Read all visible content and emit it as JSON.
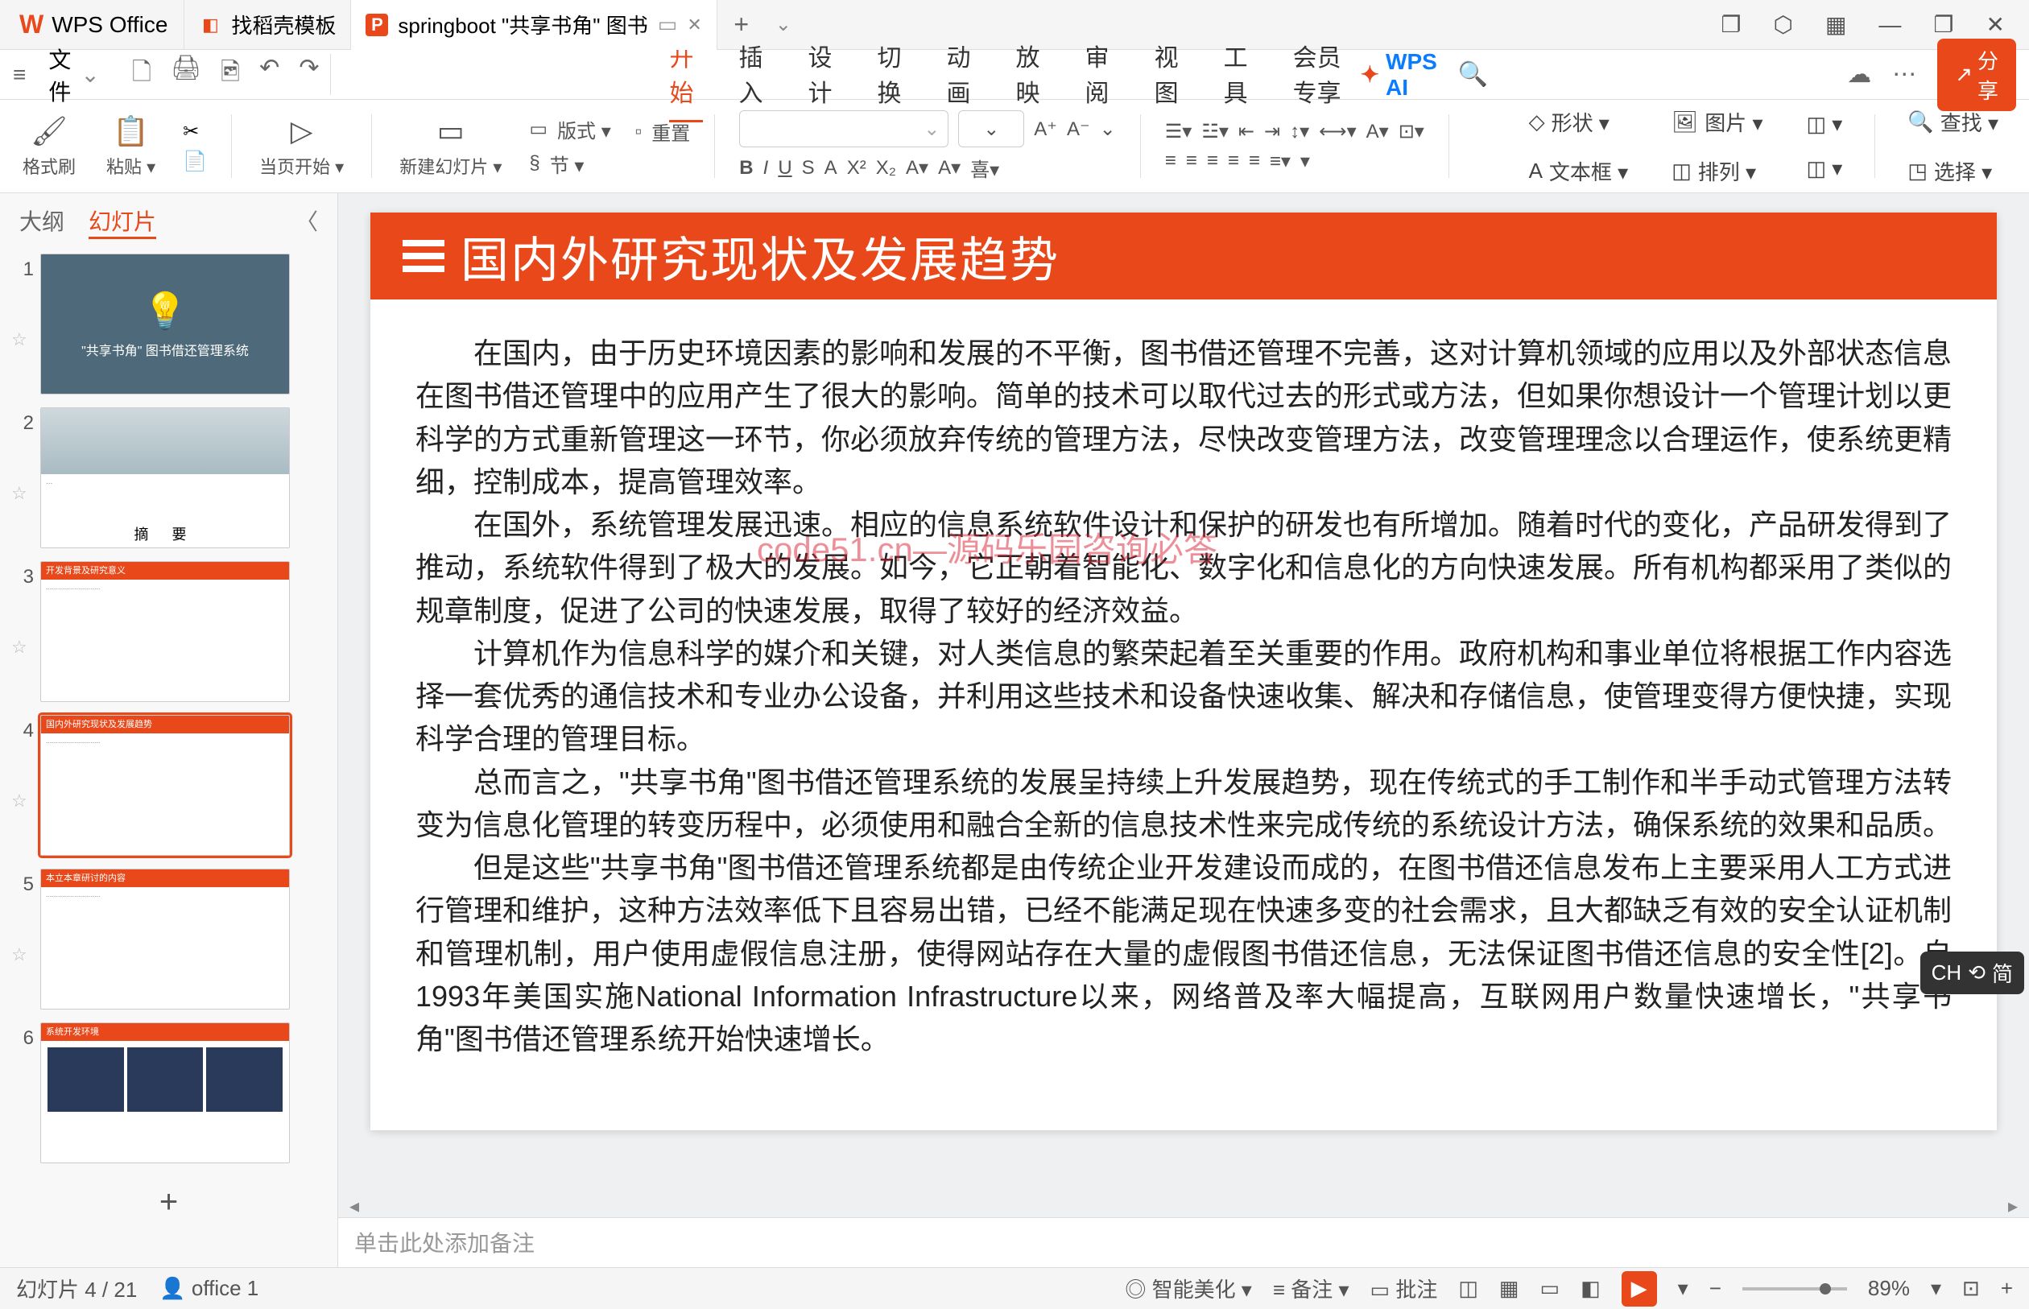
{
  "titlebar": {
    "app_name": "WPS Office",
    "tabs": [
      {
        "icon_color": "#e8481a",
        "icon": "◧",
        "label": "找稻壳模板"
      },
      {
        "icon_bg": "#e8481a",
        "icon": "P",
        "label": "springboot \"共享书角\" 图书",
        "active": true,
        "closable": true,
        "play": true
      }
    ],
    "window_icons": [
      "❐",
      "⬡",
      "▦",
      "—",
      "❐",
      "✕"
    ]
  },
  "menubar": {
    "file_label": "文件",
    "quick_icons": [
      "🗋",
      "🖨",
      "🖻",
      "↶",
      "↷"
    ],
    "tabs": [
      "开始",
      "插入",
      "设计",
      "切换",
      "动画",
      "放映",
      "审阅",
      "视图",
      "工具",
      "会员专享"
    ],
    "active_tab": 0,
    "wps_ai": "WPS AI",
    "search_icon": "🔍",
    "cloud_icon": "☁",
    "share": "分享"
  },
  "toolbar": {
    "g1": {
      "icon": "🖌",
      "label": "格式刷"
    },
    "g2": {
      "icon": "📋",
      "label": "粘贴 ▾",
      "cut_icon": "✂",
      "copy_icon": "📄"
    },
    "g3": {
      "icon": "▷",
      "label": "当页开始 ▾"
    },
    "g4": {
      "icon": "▭",
      "label": "新建幻灯片 ▾"
    },
    "g5": {
      "row1_icon": "▭",
      "row1": "版式 ▾",
      "row2_icon": "▫",
      "row2": "重置",
      "row3_icon": "§",
      "row3": "节 ▾"
    },
    "font_placeholder": "",
    "format_icons_row1": [
      "A⁺",
      "A⁻",
      "⌄",
      "Ξ",
      "Ξ",
      "Ξ",
      "Ξ",
      "Ξ"
    ],
    "format_icons_row2": [
      "B",
      "I",
      "U",
      "S",
      "A",
      "X²",
      "X₂",
      "A▾",
      "A▾",
      "喜▾",
      "≡",
      "≡",
      "≡",
      "≡",
      "≡",
      "≡",
      "≡"
    ],
    "align_row1": [
      "↕",
      "⟷",
      "A▾",
      "⊡▾"
    ],
    "right1": {
      "icon": "◇",
      "label": "形状 ▾"
    },
    "right2": {
      "icon": "🖼",
      "label": "图片 ▾"
    },
    "right3": {
      "icon": "A",
      "label": "文本框 ▾"
    },
    "right4": {
      "icon": "◫",
      "label": "排列 ▾",
      "sub": "◫ ▾"
    },
    "right5": {
      "icon": "🔍",
      "label": "查找 ▾"
    },
    "right6": {
      "icon": "◳",
      "label": "选择 ▾"
    }
  },
  "sidepanel": {
    "tab_outline": "大纲",
    "tab_slides": "幻灯片",
    "slides": [
      {
        "num": "1",
        "kind": "title",
        "title_text": "\"共享书角\" 图书借还管理系统"
      },
      {
        "num": "2",
        "kind": "abstract",
        "caption": "摘   要"
      },
      {
        "num": "3",
        "kind": "content",
        "hdr": "开发背景及研究意义"
      },
      {
        "num": "4",
        "kind": "content",
        "hdr": "国内外研究现状及发展趋势",
        "active": true
      },
      {
        "num": "5",
        "kind": "content",
        "hdr": "本立本章研讨的内容"
      },
      {
        "num": "6",
        "kind": "env",
        "hdr": "系统开发环境"
      }
    ]
  },
  "slide": {
    "title": "国内外研究现状及发展趋势",
    "watermark": "code51.cn—源码乐园咨询必答",
    "paragraphs": [
      "在国内，由于历史环境因素的影响和发展的不平衡，图书借还管理不完善，这对计算机领域的应用以及外部状态信息在图书借还管理中的应用产生了很大的影响。简单的技术可以取代过去的形式或方法，但如果你想设计一个管理计划以更科学的方式重新管理这一环节，你必须放弃传统的管理方法，尽快改变管理方法，改变管理理念以合理运作，使系统更精细，控制成本，提高管理效率。",
      "在国外，系统管理发展迅速。相应的信息系统软件设计和保护的研发也有所增加。随着时代的变化，产品研发得到了推动，系统软件得到了极大的发展。如今，它正朝着智能化、数字化和信息化的方向快速发展。所有机构都采用了类似的规章制度，促进了公司的快速发展，取得了较好的经济效益。",
      "计算机作为信息科学的媒介和关键，对人类信息的繁荣起着至关重要的作用。政府机构和事业单位将根据工作内容选择一套优秀的通信技术和专业办公设备，并利用这些技术和设备快速收集、解决和存储信息，使管理变得方便快捷，实现科学合理的管理目标。",
      "总而言之，\"共享书角\"图书借还管理系统的发展呈持续上升发展趋势，现在传统式的手工制作和半手动式管理方法转变为信息化管理的转变历程中，必须使用和融合全新的信息技术性来完成传统的系统设计方法，确保系统的效果和品质。",
      "但是这些\"共享书角\"图书借还管理系统都是由传统企业开发建设而成的，在图书借还信息发布上主要采用人工方式进行管理和维护，这种方法效率低下且容易出错，已经不能满足现在快速多变的社会需求，且大都缺乏有效的安全认证机制和管理机制，用户使用虚假信息注册，使得网站存在大量的虚假图书借还信息，无法保证图书借还信息的安全性[2]。自1993年美国实施National Information Infrastructure以来，网络普及率大幅提高，互联网用户数量快速增长，\"共享书角\"图书借还管理系统开始快速增长。"
    ]
  },
  "notes": {
    "placeholder": "单击此处添加备注"
  },
  "statusbar": {
    "slide_pos": "幻灯片 4 / 21",
    "office": "office 1",
    "smart": "智能美化 ▾",
    "notes": "备注 ▾",
    "comment": "批注",
    "views": [
      "◫",
      "◫◫",
      "▭",
      "◧"
    ],
    "zoom": "89%"
  },
  "ime": {
    "lang": "CH",
    "icon": "⟲",
    "mode": "简"
  }
}
